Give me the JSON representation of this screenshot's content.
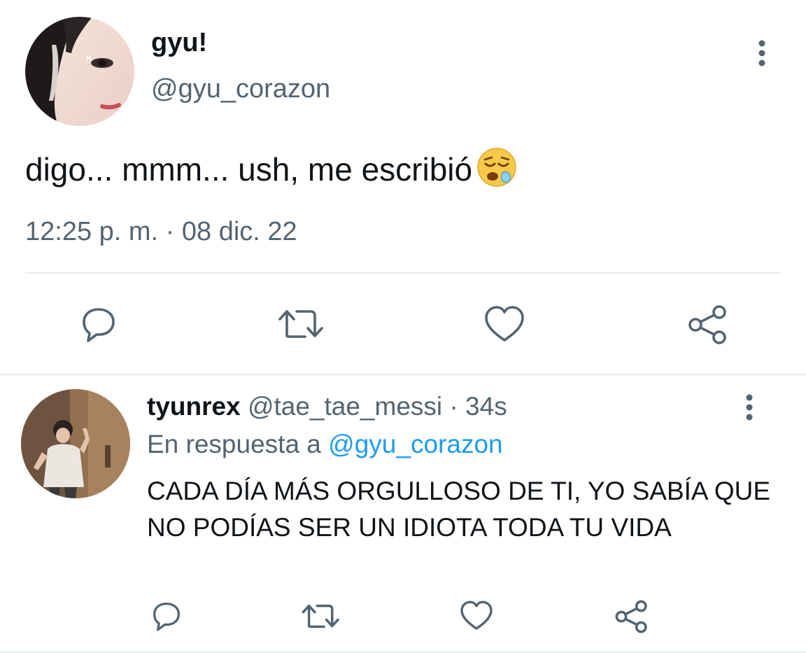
{
  "tweet": {
    "display_name": "gyu!",
    "handle": "@gyu_corazon",
    "text": "digo... mmm... ush, me escribió",
    "emoji": "sleepy-face",
    "timestamp": "12:25 p. m. · 08 dic. 22"
  },
  "reply": {
    "display_name": "tyunrex",
    "handle": "@tae_tae_messi",
    "separator": "·",
    "time": "34s",
    "replying_to_prefix": "En respuesta a",
    "replying_to_handle": "@gyu_corazon",
    "text": "CADA DÍA MÁS ORGULLOSO DE TI, YO SABÍA QUE NO PODÍAS SER UN IDIOTA TODA TU VIDA"
  },
  "colors": {
    "text_primary": "#0f1419",
    "text_secondary": "#536471",
    "link": "#1d9bf0",
    "divider": "#e6ecf0"
  },
  "icons": [
    "more-vertical-icon",
    "reply-icon",
    "retweet-icon",
    "like-icon",
    "share-icon",
    "sleepy-face-emoji"
  ]
}
